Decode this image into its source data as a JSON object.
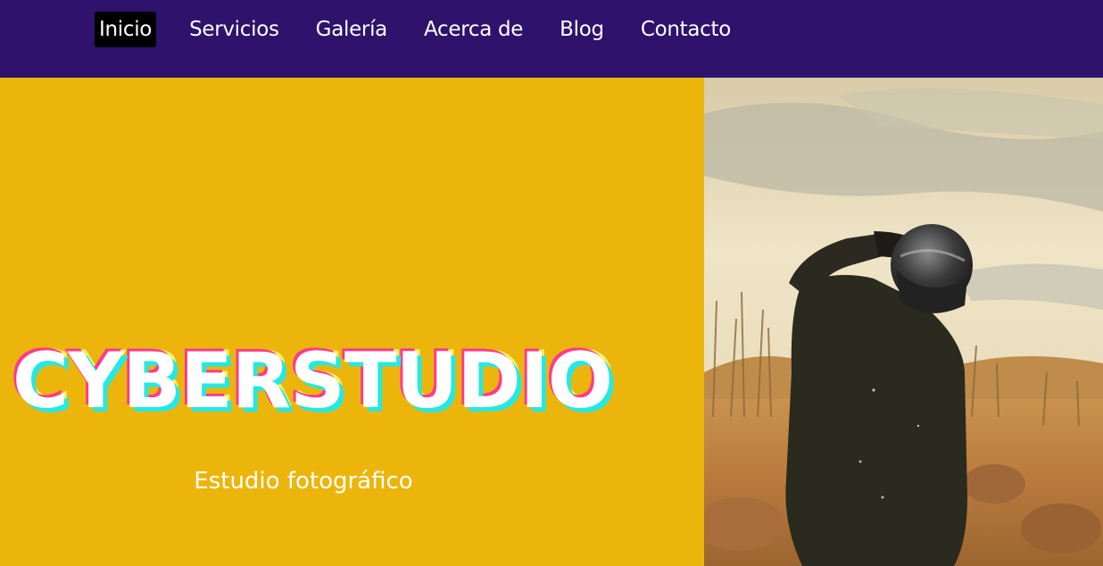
{
  "nav": {
    "items": [
      {
        "label": "Inicio",
        "active": true
      },
      {
        "label": "Servicios",
        "active": false
      },
      {
        "label": "Galería",
        "active": false
      },
      {
        "label": "Acerca de",
        "active": false
      },
      {
        "label": "Blog",
        "active": false
      },
      {
        "label": "Contacto",
        "active": false
      }
    ]
  },
  "hero": {
    "title": "CYBERSTUDIO",
    "subtitle": "Estudio fotográfico",
    "photo_alt": "Persona con casco de motociclista en un campo seco bajo un cielo nublado"
  },
  "colors": {
    "nav_background": "#2e126b",
    "hero_background": "#ecb50b",
    "active_nav_background": "#000000",
    "title_shadow_cyan": "#27e8e1",
    "title_shadow_pink": "#ff3a8c"
  }
}
